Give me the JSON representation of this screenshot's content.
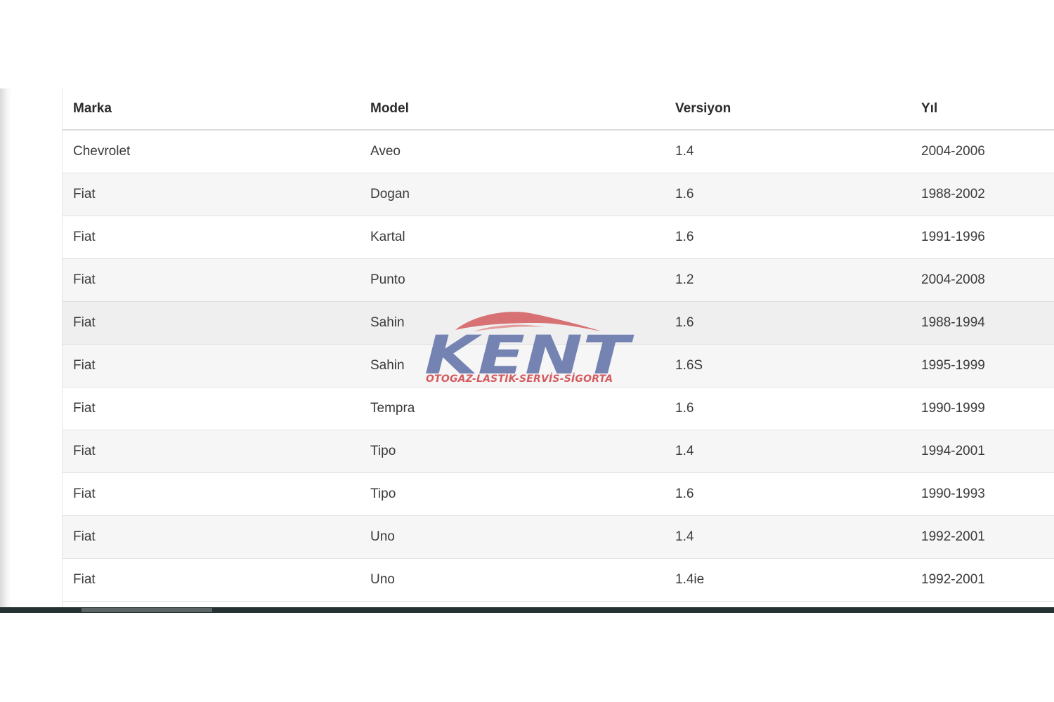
{
  "table": {
    "headers": [
      "Marka",
      "Model",
      "Versiyon",
      "Yıl"
    ],
    "rows": [
      [
        "Chevrolet",
        "Aveo",
        "1.4",
        "2004-2006"
      ],
      [
        "Fiat",
        "Dogan",
        "1.6",
        "1988-2002"
      ],
      [
        "Fiat",
        "Kartal",
        "1.6",
        "1991-1996"
      ],
      [
        "Fiat",
        "Punto",
        "1.2",
        "2004-2008"
      ],
      [
        "Fiat",
        "Sahin",
        "1.6",
        "1988-1994"
      ],
      [
        "Fiat",
        "Sahin",
        "1.6S",
        "1995-1999"
      ],
      [
        "Fiat",
        "Tempra",
        "1.6",
        "1990-1999"
      ],
      [
        "Fiat",
        "Tipo",
        "1.4",
        "1994-2001"
      ],
      [
        "Fiat",
        "Tipo",
        "1.6",
        "1990-1993"
      ],
      [
        "Fiat",
        "Uno",
        "1.4",
        "1992-2001"
      ],
      [
        "Fiat",
        "Uno",
        "1.4ie",
        "1992-2001"
      ]
    ],
    "hovered_row_index": 4
  },
  "watermark": {
    "brand": "KENT",
    "tagline": "OTOGAZ-LASTİK-SERVİS-SİGORTA",
    "brand_color": "#6b7aae",
    "accent_color": "#d45a5e"
  },
  "scrollbar": {
    "orientation": "horizontal",
    "position_fraction": 0.08
  }
}
